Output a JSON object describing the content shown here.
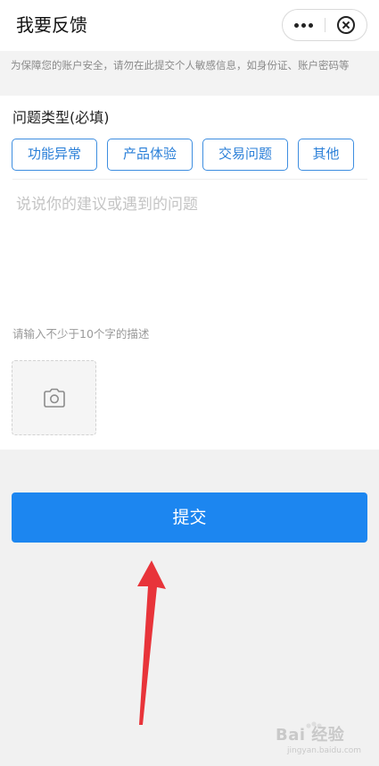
{
  "header": {
    "title": "我要反馈"
  },
  "capsule": {
    "more_icon": "more-dots-icon",
    "close_icon": "close-circle-icon"
  },
  "notice": {
    "text": "为保障您的账户安全，请勿在此提交个人敏感信息，如身份证、账户密码等"
  },
  "form": {
    "section_label": "问题类型(必填)",
    "types": [
      {
        "label": "功能异常"
      },
      {
        "label": "产品体验"
      },
      {
        "label": "交易问题"
      },
      {
        "label": "其他"
      }
    ],
    "description_placeholder": "说说你的建议或遇到的问题",
    "min_length_hint": "请输入不少于10个字的描述",
    "upload_icon": "camera-icon"
  },
  "submit": {
    "label": "提交"
  },
  "annotation": {
    "arrow_color": "#e8343a"
  },
  "watermark": {
    "text": "Bai 经验",
    "sub": "jingyan.baidu.com"
  },
  "colors": {
    "accent": "#1c86f0",
    "chip_border": "#3e8ee0",
    "background": "#f1f1f1"
  }
}
